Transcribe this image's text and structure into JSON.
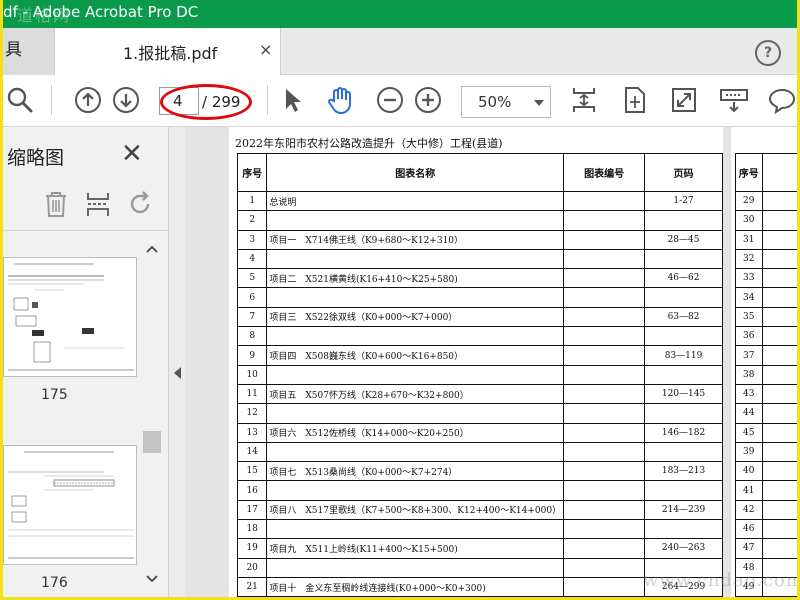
{
  "window": {
    "title": "df - Adobe Acrobat Pro DC",
    "watermark_top": "道格网",
    "watermark_bottom": "www.cndao.com"
  },
  "tabs": {
    "tools_label": "具",
    "doc_label": "1.报批稿.pdf",
    "close_glyph": "×",
    "help_glyph": "?"
  },
  "toolbar": {
    "current_page": "4",
    "total_pages": "/ 299",
    "zoom": "50%"
  },
  "colors": {
    "titlebar": "#0a9b4a",
    "frame": "#f2e01a",
    "highlight": "#e00a0a",
    "hand_tool": "#2a6fd6"
  },
  "sidebar": {
    "title": "缩略图",
    "close_glyph": "✕",
    "thumbnails": [
      {
        "label": "175"
      },
      {
        "label": "176"
      }
    ]
  },
  "document": {
    "title": "2022年东阳市农村公路改造提升（大中修）工程(县道)",
    "headers": {
      "no": "序号",
      "name": "图表名称",
      "code": "图表编号",
      "page": "页码"
    },
    "rows": [
      {
        "no": "1",
        "name": "总说明",
        "code": "",
        "page": "1-27"
      },
      {
        "no": "2",
        "name": "",
        "code": "",
        "page": ""
      },
      {
        "no": "3",
        "name": "项目一　X714佛王线（K9+680～K12+310）",
        "code": "",
        "page": "28—45"
      },
      {
        "no": "4",
        "name": "",
        "code": "",
        "page": ""
      },
      {
        "no": "5",
        "name": "项目二　X521横黄线(K16+410～K25+580)",
        "code": "",
        "page": "46—62"
      },
      {
        "no": "6",
        "name": "",
        "code": "",
        "page": ""
      },
      {
        "no": "7",
        "name": "项目三　X522徐双线（K0+000～K7+000）",
        "code": "",
        "page": "63—82"
      },
      {
        "no": "8",
        "name": "",
        "code": "",
        "page": ""
      },
      {
        "no": "9",
        "name": "项目四　X508巍东线（K0+600～K16+850）",
        "code": "",
        "page": "83—119"
      },
      {
        "no": "10",
        "name": "",
        "code": "",
        "page": ""
      },
      {
        "no": "11",
        "name": "项目五　X507怀万线（K28+670～K32+800）",
        "code": "",
        "page": "120—145"
      },
      {
        "no": "12",
        "name": "",
        "code": "",
        "page": ""
      },
      {
        "no": "13",
        "name": "项目六　X512佐桥线（K14+000～K20+250）",
        "code": "",
        "page": "146—182"
      },
      {
        "no": "14",
        "name": "",
        "code": "",
        "page": ""
      },
      {
        "no": "15",
        "name": "项目七　X513桑尚线（K0+000～K7+274）",
        "code": "",
        "page": "183—213"
      },
      {
        "no": "16",
        "name": "",
        "code": "",
        "page": ""
      },
      {
        "no": "17",
        "name": "项目八　X517里歌线（K7+500～K8+300、K12+400～K14+000）",
        "code": "",
        "page": "214—239"
      },
      {
        "no": "18",
        "name": "",
        "code": "",
        "page": ""
      },
      {
        "no": "19",
        "name": "项目九　X511上岭线(K11+400～K15+500)",
        "code": "",
        "page": "240—263"
      },
      {
        "no": "20",
        "name": "",
        "code": "",
        "page": ""
      },
      {
        "no": "21",
        "name": "项目十　金义东至稠岭线连接线(K0+000～K0+300)",
        "code": "",
        "page": "264—299"
      }
    ],
    "page2_header": "序号",
    "page2_rows": [
      "29",
      "30",
      "31",
      "32",
      "33",
      "34",
      "35",
      "36",
      "37",
      "38",
      "43",
      "44",
      "45",
      "39",
      "40",
      "41",
      "42",
      "46",
      "47",
      "48",
      "49"
    ]
  }
}
